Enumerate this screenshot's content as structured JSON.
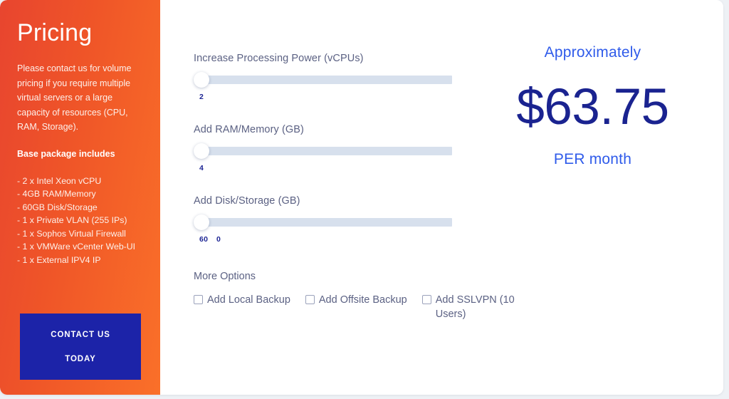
{
  "sidebar": {
    "title": "Pricing",
    "intro": "Please contact us for volume pricing if you require multiple virtual servers or a large capacity of resources (CPU, RAM, Storage).",
    "subtitle": "Base package includes",
    "features": [
      "- 2 x Intel Xeon vCPU",
      "- 4GB RAM/Memory",
      "- 60GB Disk/Storage",
      "- 1 x Private VLAN (255 IPs)",
      "- 1 x Sophos Virtual Firewall",
      "- 1 x VMWare vCenter Web-UI",
      "- 1 x External IPV4 IP"
    ],
    "contact_button": {
      "line1": "CONTACT US",
      "line2": "TODAY"
    },
    "colors": {
      "gradient_start": "#e8452f",
      "gradient_end": "#fa7029",
      "button_bg": "#1c23a8"
    }
  },
  "sliders": [
    {
      "label": "Increase Processing Power (vCPUs)",
      "value": "2",
      "secondary_value": "",
      "handle_percent": 0
    },
    {
      "label": "Add RAM/Memory (GB)",
      "value": "4",
      "secondary_value": "",
      "handle_percent": 0
    },
    {
      "label": "Add Disk/Storage (GB)",
      "value": "60",
      "secondary_value": "0",
      "handle_percent": 0
    }
  ],
  "more_options": {
    "title": "More Options",
    "checkboxes": [
      {
        "label": "Add Local Backup",
        "checked": false
      },
      {
        "label": "Add Offsite Backup",
        "checked": false
      },
      {
        "label": "Add SSLVPN (10 Users)",
        "checked": false
      }
    ]
  },
  "price": {
    "approx_label": "Approximately",
    "amount": "$63.75",
    "period_label": "PER month",
    "colors": {
      "accent": "#2f5bea",
      "amount": "#1a2390"
    }
  }
}
